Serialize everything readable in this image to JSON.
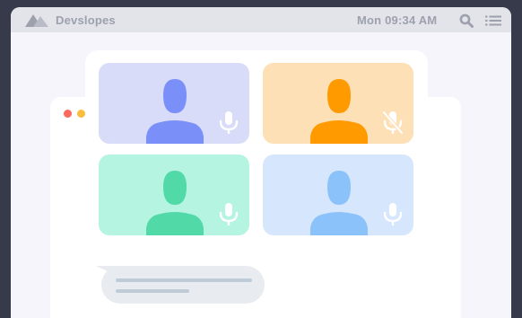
{
  "menubar": {
    "brand": "Devslopes",
    "clock": "Mon 09:34 AM"
  },
  "icons": {
    "logo": "mountain-logo",
    "search": "search-icon",
    "list": "list-menu-icon",
    "mic": "microphone-icon",
    "mic_muted": "microphone-muted-icon"
  },
  "colors": {
    "background": "#363a4a",
    "window": "#ffffff",
    "menubar": "#e2e4ea",
    "traffic_red": "#fb6a5f",
    "traffic_yellow": "#fbbd3c"
  },
  "participants": [
    {
      "tile_color": "#d8dcf9",
      "person_color": "#7b8ff8",
      "muted": false
    },
    {
      "tile_color": "#fde0b6",
      "person_color": "#ff9a00",
      "muted": true
    },
    {
      "tile_color": "#b6f4e2",
      "person_color": "#52d9a8",
      "muted": false
    },
    {
      "tile_color": "#d5e6fd",
      "person_color": "#8cc2fa",
      "muted": false
    }
  ],
  "chat": {
    "bubble_color": "#e8ecf0",
    "line_color": "#bfccd8"
  }
}
